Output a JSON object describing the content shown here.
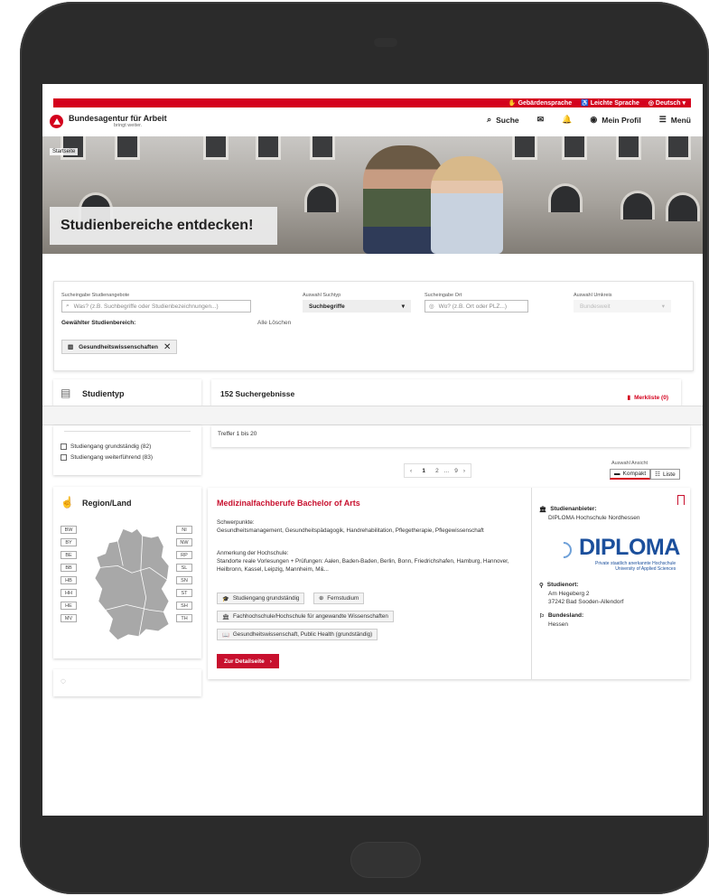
{
  "topbar": {
    "sign_language": "Gebärdensprache",
    "easy_language": "Leichte Sprache",
    "language": "Deutsch"
  },
  "header": {
    "brand": "Bundesagentur für Arbeit",
    "claim": "bringt weiter.",
    "search": "Suche",
    "profile": "Mein Profil",
    "menu": "Menü"
  },
  "hero": {
    "breadcrumb": "Startseite",
    "title": "Studienbereiche entdecken!"
  },
  "search": {
    "query_label": "Sucheingabe Studienangebote",
    "query_placeholder": "Was? (z.B. Suchbegriffe oder Studienbezeichnungen...)",
    "type_label": "Auswahl Suchtyp",
    "type_value": "Suchbegriffe",
    "place_label": "Sucheingabe Ort",
    "place_placeholder": "Wo? (z.B. Ort oder PLZ...)",
    "radius_label": "Auswahl Umkreis",
    "radius_value": "Bundesweit",
    "chosen_label": "Gewählter Studienbereich:",
    "clear_all": "Alle Löschen",
    "chip": "Gesundheitswissenschaften"
  },
  "filters": {
    "studientyp_title": "Studientyp",
    "studientyp_options": [
      "Studiengang grundständig (82)",
      "Studiengang weiterführend (83)"
    ],
    "region_title": "Region/Land",
    "states_left": [
      "BW",
      "BY",
      "BE",
      "BB",
      "HB",
      "HH",
      "HE",
      "MV"
    ],
    "states_right": [
      "NI",
      "NW",
      "RP",
      "SL",
      "SN",
      "ST",
      "SH",
      "TH"
    ]
  },
  "results": {
    "count": "152 Suchergebnisse",
    "merkliste": "Merkliste (0)",
    "treffer": "Treffer 1 bis 20",
    "pages": [
      "1",
      "2",
      "...",
      "9"
    ],
    "view_label": "Auswahl Ansicht",
    "view_compact": "Kompakt",
    "view_list": "Liste"
  },
  "result_card": {
    "title": "Medizinalfachberufe Bachelor of Arts",
    "focus_label": "Schwerpunkte:",
    "focus_text": "Gesundheitsmanagement, Gesundheitspädagogik, Handrehabilitation, Pflegetherapie, Pflegewissenschaft",
    "note_label": "Anmerkung der Hochschule:",
    "note_text": "Standorte reale Vorlesungen + Prüfungen: Aalen, Baden-Baden, Berlin, Bonn, Friedrichshafen, Hamburg, Hannover, Heilbronn, Kassel, Leipzig, Mannheim, M&...",
    "tag_type": "Studiengang grundständig",
    "tag_mode": "Fernstudium",
    "tag_school": "Fachhochschule/Hochschule für angewandte Wissenschaften",
    "tag_area": "Gesundheitswissenschaft, Public Health (grundständig)",
    "detail_button": "Zur Detailseite",
    "provider_label": "Studienanbieter:",
    "provider": "DIPLOMA Hochschule Nordhessen",
    "logo_word": "DIPLOMA",
    "logo_sub1": "Private staatlich anerkannte Hochschule",
    "logo_sub2": "University of Applied Sciences",
    "location_label": "Studienort:",
    "street": "Am Hegeberg 2",
    "city": "37242 Bad Sooden-Allendorf",
    "state_label": "Bundesland:",
    "state": "Hessen"
  },
  "colors": {
    "brand_red": "#d4001d",
    "title_red": "#c8102e",
    "diploma_blue": "#1b4f9c"
  }
}
